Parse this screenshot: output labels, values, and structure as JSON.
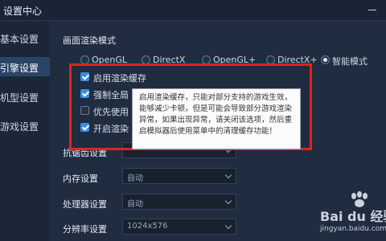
{
  "window": {
    "title": "设置中心"
  },
  "sidebar": {
    "items": [
      {
        "label": "基本设置"
      },
      {
        "label": "引擎设置"
      },
      {
        "label": "机型设置"
      },
      {
        "label": "游戏设置"
      }
    ]
  },
  "render_mode": {
    "title": "画面渲染模式",
    "options": [
      {
        "label": "OpenGL",
        "selected": false
      },
      {
        "label": "DirectX",
        "selected": false
      },
      {
        "label": "OpenGL+",
        "selected": false
      },
      {
        "label": "DirectX+",
        "selected": false
      },
      {
        "label": "智能模式",
        "selected": true
      }
    ]
  },
  "checkboxes": [
    {
      "label": "启用渲染缓存",
      "checked": true
    },
    {
      "label": "强制全局",
      "checked": true
    },
    {
      "label": "优先使用",
      "checked": false
    },
    {
      "label": "开启渲染",
      "checked": true
    }
  ],
  "tooltip": {
    "text": "启用渲染缓存，只能对部分支持的游戏生效，能够减少卡顿，但是可能会导致部分游戏渲染异常，如果出现异常，请关闭该选项，然后重启模拟器后使用菜单中的清理缓存功能！"
  },
  "fields": [
    {
      "label": "抗锯齿设置",
      "value": ""
    },
    {
      "label": "内存设置",
      "value": "自动"
    },
    {
      "label": "处理器设置",
      "value": "自动"
    },
    {
      "label": "分辨率设置",
      "value": "1024x576"
    }
  ],
  "watermark": {
    "brand": "Bai du 经验",
    "site": "jingyan.baidu.com"
  },
  "colors": {
    "accent": "#3a8ee6",
    "highlight_frame": "#e2231a",
    "background": "#202c40"
  }
}
